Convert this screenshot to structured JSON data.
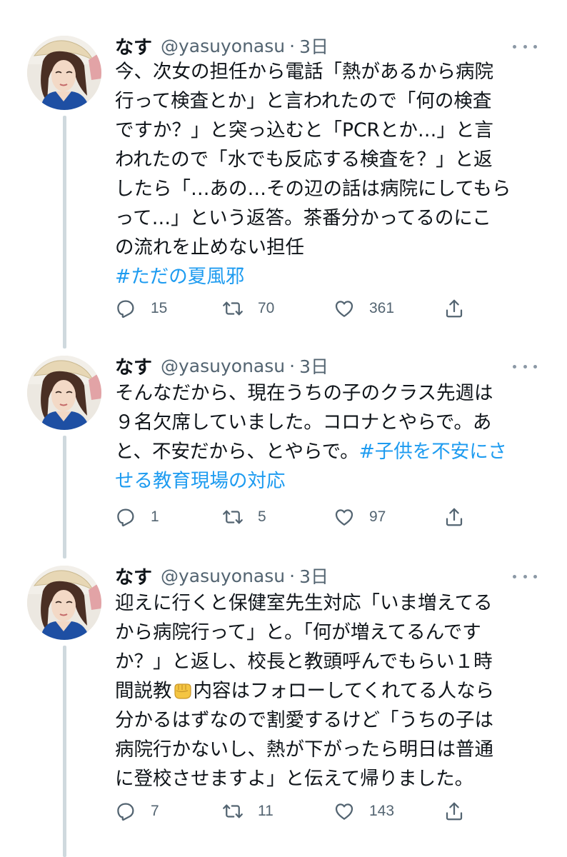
{
  "tweets": [
    {
      "name": "なす",
      "handle": "@yasuyonasu",
      "separator": "·",
      "time": "3日",
      "lines": [
        "今、次女の担任から電話「熱があるから病院",
        "行って検査とか」と言われたので「何の検査",
        "ですか？」と突っ込むと「PCRとか…」と言",
        "われたので「水でも反応する検査を？」と返",
        "したら「…あの…その辺の話は病院にしてもら",
        "って…」という返答。茶番分かってるのにこ",
        "の流れを止めない担任"
      ],
      "hashtag": "#ただの夏風邪",
      "replies": "15",
      "retweets": "70",
      "likes": "361"
    },
    {
      "name": "なす",
      "handle": "@yasuyonasu",
      "separator": "·",
      "time": "3日",
      "lines": [
        "そんなだから、現在うちの子のクラス先週は",
        "９名欠席していました。コロナとやらで。あ",
        "と、不安だから、とやらで。"
      ],
      "hashtag_inline": "#子供を不安にさ",
      "hashtag_cont": "せる教育現場の対応",
      "replies": "1",
      "retweets": "5",
      "likes": "97"
    },
    {
      "name": "なす",
      "handle": "@yasuyonasu",
      "separator": "·",
      "time": "3日",
      "lines": [
        "迎えに行くと保健室先生対応「いま増えてる",
        "から病院行って」と。「何が増えてるんです",
        "か？」と返し、校長と教頭呼んでもらい１時",
        "間説教",
        "内容はフォローしてくれてる人なら",
        "分かるはずなので割愛するけど「うちの子は",
        "病院行かないし、熱が下がったら明日は普通",
        "に登校させますよ」と伝えて帰りました。"
      ],
      "emoji": "fist-emoji",
      "replies": "7",
      "retweets": "11",
      "likes": "143"
    }
  ],
  "colors": {
    "text": "#0f1419",
    "secondary": "#536471",
    "link": "#1d9bf0",
    "thread_line": "#cfd9de"
  },
  "icons": [
    "reply-icon",
    "retweet-icon",
    "like-icon",
    "share-icon",
    "more-icon"
  ]
}
